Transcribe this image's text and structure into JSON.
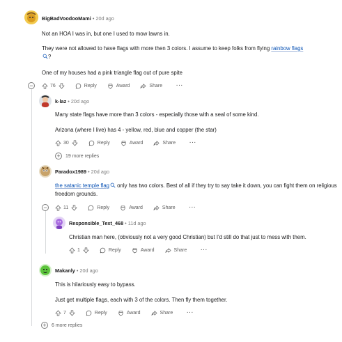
{
  "comments": [
    {
      "user": "BigBadVoodooMami",
      "separator": "•",
      "time": "20d ago",
      "paragraphs": {
        "p1": "Not an HOA I was in, but one I used to mow lawns in.",
        "p2_before": "They were not allowed to have flags with more then 3 colors. I assume to keep folks from flying ",
        "p2_link": "rainbow flags",
        "p2_after": "?",
        "p3": "One of my houses had a pink triangle flag out of pure spite"
      },
      "votes": "76",
      "reply": "Reply",
      "award": "Award",
      "share": "Share",
      "more": "···",
      "collapse": "−"
    },
    {
      "user": "k-laz",
      "separator": "•",
      "time": "20d ago",
      "paragraphs": {
        "p1": "Many state flags have more than 3 colors - especially those with a seal of some kind.",
        "p2": "Arizona (where I live) has 4 - yellow, red, blue and copper (the star)"
      },
      "votes": "30",
      "reply": "Reply",
      "award": "Award",
      "share": "Share",
      "more": "···",
      "more_replies": "19 more replies"
    },
    {
      "user": "Paradox1989",
      "separator": "•",
      "time": "20d ago",
      "paragraphs": {
        "p1_link": "the satanic temple flag",
        "p1_after": " only has two colors. Best of all if they try to say take it down, you can fight them on religious freedom grounds."
      },
      "votes": "11",
      "reply": "Reply",
      "award": "Award",
      "share": "Share",
      "more": "···",
      "collapse": "−"
    },
    {
      "user": "Responsible_Text_468",
      "separator": "•",
      "time": "11d ago",
      "paragraphs": {
        "p1": "Christian man here, (obviously not a very good Christian) but I'd still do that just to mess with them."
      },
      "votes": "1",
      "reply": "Reply",
      "award": "Award",
      "share": "Share",
      "more": "···"
    },
    {
      "user": "Makanly",
      "separator": "•",
      "time": "20d ago",
      "paragraphs": {
        "p1": "This is hilariously easy to bypass.",
        "p2": "Just get multiple flags, each with 3 of the colors. Then fly them together."
      },
      "votes": "7",
      "reply": "Reply",
      "award": "Award",
      "share": "Share",
      "more": "···"
    }
  ],
  "bottom_more_replies": "6 more replies",
  "colors": {
    "link": "#0a53b5",
    "muted": "#7c7c7c",
    "text": "#1a1a1b"
  }
}
